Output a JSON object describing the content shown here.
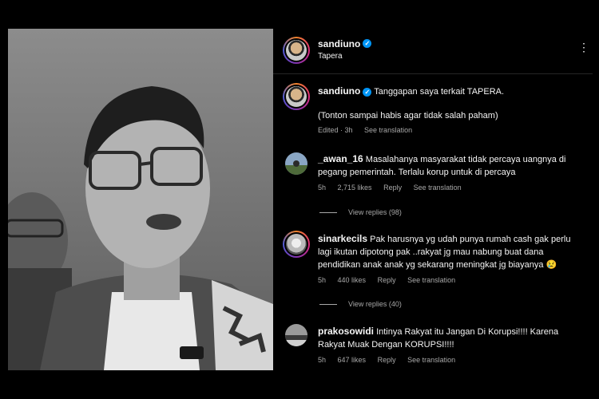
{
  "post": {
    "username": "sandiuno",
    "location": "Tapera"
  },
  "caption": {
    "username": "sandiuno",
    "text": "Tanggapan saya terkait TAPERA.",
    "text2": "(Tonton sampai habis agar tidak salah paham)",
    "edited": "Edited · 3h",
    "see_translation": "See translation"
  },
  "comments": [
    {
      "username": "_awan_16",
      "line1": "Masalahanya masyarakat tidak percaya uangnya di",
      "line2": "pegang pemerintah. Terlalu korup untuk di percaya",
      "time": "5h",
      "likes": "2,715 likes",
      "reply": "Reply",
      "see_translation": "See translation",
      "view_replies": "View replies (98)"
    },
    {
      "username": "sinarkecils",
      "line1": "Pak harusnya yg udah punya rumah cash gak perlu",
      "line2": "lagi ikutan dipotong pak ..rakyat jg mau nabung buat dana",
      "line3": "pendidikan anak anak yg sekarang meningkat jg biayanya 😢",
      "time": "5h",
      "likes": "440 likes",
      "reply": "Reply",
      "see_translation": "See translation",
      "view_replies": "View replies (40)"
    },
    {
      "username": "prakosowidi",
      "line1": "Intinya Rakyat itu Jangan Di Korupsi!!!! Karena",
      "line2": "Rakyat Muak Dengan KORUPSI!!!!",
      "time": "5h",
      "likes": "647 likes",
      "reply": "Reply",
      "see_translation": "See translation"
    }
  ],
  "icons": {
    "verified": "verified-badge-icon",
    "more": "more-options-icon"
  },
  "colors": {
    "background": "#000000",
    "text": "#f5f5f5",
    "muted": "#a8a8a8",
    "verified": "#0095f6"
  }
}
